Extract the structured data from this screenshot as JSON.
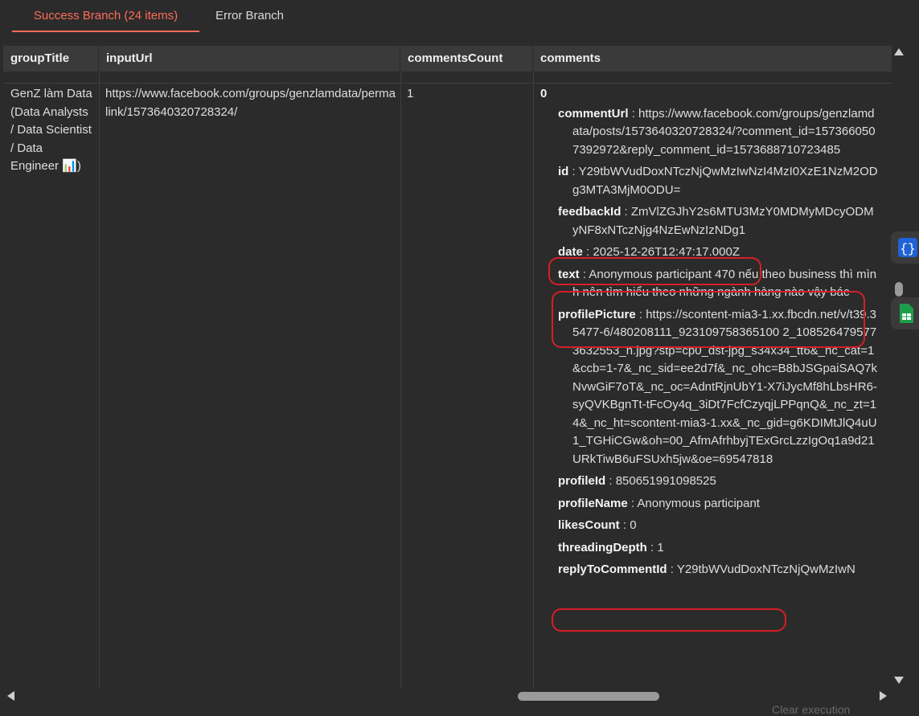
{
  "tabs": {
    "success": "Success Branch (24 items)",
    "error": "Error Branch"
  },
  "table": {
    "headers": [
      "groupTitle",
      "inputUrl",
      "commentsCount",
      "comments"
    ],
    "row": {
      "groupTitle": "GenZ làm Data (Data Analysts / Data Scientist / Data Engineer 📊)",
      "inputUrl": "https://www.facebook.com/groups/genzlamdata/permalink/1573640320728324/",
      "commentsCount": "1",
      "comments": {
        "index": "0",
        "fields": [
          {
            "key": "commentUrl",
            "value": "https://www.facebook.com/groups/genzlamdata/posts/1573640320728324/?comment_id=1573660507392972&reply_comment_id=1573688710723485"
          },
          {
            "key": "id",
            "value": "Y29tbWVudDoxNTczNjQwMzIwNzI4MzI0XzE1NzM2ODg3MTA3MjM0ODU="
          },
          {
            "key": "feedbackId",
            "value": "ZmVlZGJhY2s6MTU3MzY0MDMyMDcyODMyNF8xNTczNjg4NzEwNzIzNDg1"
          },
          {
            "key": "date",
            "value": "2025-12-26T12:47:17.000Z"
          },
          {
            "key": "text",
            "value": "Anonymous participant 470 nếu theo business thì mình nên tìm hiểu theo những ngành hàng nào vậy bác"
          },
          {
            "key": "profilePicture",
            "value": "https://scontent-mia3-1.xx.fbcdn.net/v/t39.35477-6/480208111_923109758365100 2_1085264795773632553_n.jpg?stp=cp0_dst-jpg_s34x34_tt6&_nc_cat=1&ccb=1-7&_nc_sid=ee2d7f&_nc_ohc=B8bJSGpaiSAQ7kNvwGiF7oT&_nc_oc=AdntRjnUbY1-X7iJycMf8hLbsHR6-syQVKBgnTt-tFcOy4q_3iDt7FcfCzyqjLPPqnQ&_nc_zt=14&_nc_ht=scontent-mia3-1.xx&_nc_gid=g6KDIMtJlQ4uU1_TGHiCGw&oh=00_AfmAfrhbyjTExGrcLzzIgOq1a9d21URkTiwB6uFSUxh5jw&oe=69547818"
          },
          {
            "key": "profileId",
            "value": "850651991098525"
          },
          {
            "key": "profileName",
            "value": "Anonymous participant"
          },
          {
            "key": "likesCount",
            "value": "0"
          },
          {
            "key": "threadingDepth",
            "value": "1"
          },
          {
            "key": "replyToCommentId",
            "value": "Y29tbWVudDoxNTczNjQwMzIwN"
          }
        ]
      }
    }
  },
  "footer": {
    "clear_execution": "Clear execution"
  },
  "colors": {
    "accent": "#ff6d5a",
    "highlight": "#d61f26",
    "background": "#2b2b2b"
  }
}
